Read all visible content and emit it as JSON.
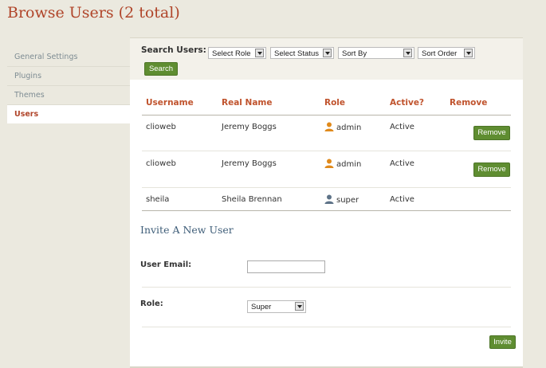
{
  "page": {
    "title": "Browse Users (2 total)"
  },
  "sidebar": {
    "items": [
      {
        "label": "General Settings",
        "active": false
      },
      {
        "label": "Plugins",
        "active": false
      },
      {
        "label": "Themes",
        "active": false
      },
      {
        "label": "Users",
        "active": true
      }
    ]
  },
  "search": {
    "label": "Search Users:",
    "role_select": "Select Role",
    "status_select": "Select Status",
    "sort_by_select": "Sort By",
    "sort_order_select": "Sort Order",
    "button": "Search"
  },
  "table": {
    "headers": [
      "Username",
      "Real Name",
      "Role",
      "Active?",
      "Remove"
    ],
    "rows": [
      {
        "username": "clioweb",
        "real_name": "Jeremy Boggs",
        "role": "admin",
        "role_icon": "admin-user-icon",
        "active": "Active",
        "remove": "Remove"
      },
      {
        "username": "clioweb",
        "real_name": "Jeremy Boggs",
        "role": "admin",
        "role_icon": "admin-user-icon",
        "active": "Active",
        "remove": "Remove"
      },
      {
        "username": "sheila",
        "real_name": "Sheila Brennan",
        "role": "super",
        "role_icon": "super-user-icon",
        "active": "Active",
        "remove": ""
      }
    ]
  },
  "invite": {
    "title": "Invite A New User",
    "email_label": "User Email:",
    "email_value": "",
    "role_label": "Role:",
    "role_value": "Super",
    "button": "Invite"
  },
  "colors": {
    "accent": "#b0452a",
    "button_green": "#5f8d31",
    "section_blue": "#3e5d78",
    "background": "#ebe9df"
  }
}
